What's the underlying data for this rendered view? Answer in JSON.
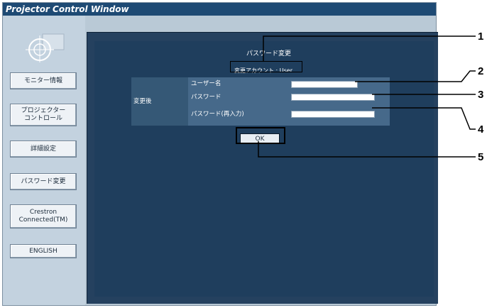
{
  "window": {
    "title": "Projector Control Window"
  },
  "sidebar": {
    "items": [
      {
        "label": "モニター情報"
      },
      {
        "label": "プロジェクター\nコントロール"
      },
      {
        "label": "詳細設定"
      },
      {
        "label": "パスワード変更"
      },
      {
        "label": "Crestron\nConnected(TM)"
      },
      {
        "label": "ENGLISH"
      }
    ]
  },
  "main": {
    "heading": "パスワード変更",
    "account": "変更アカウント : User",
    "after_label": "変更後",
    "fields": [
      {
        "label": "ユーザー名",
        "value": ""
      },
      {
        "label": "パスワード",
        "value": ""
      },
      {
        "label": "パスワード(再入力)",
        "value": ""
      }
    ],
    "ok_label": "OK"
  },
  "callouts": [
    "1",
    "2",
    "3",
    "4",
    "5"
  ]
}
